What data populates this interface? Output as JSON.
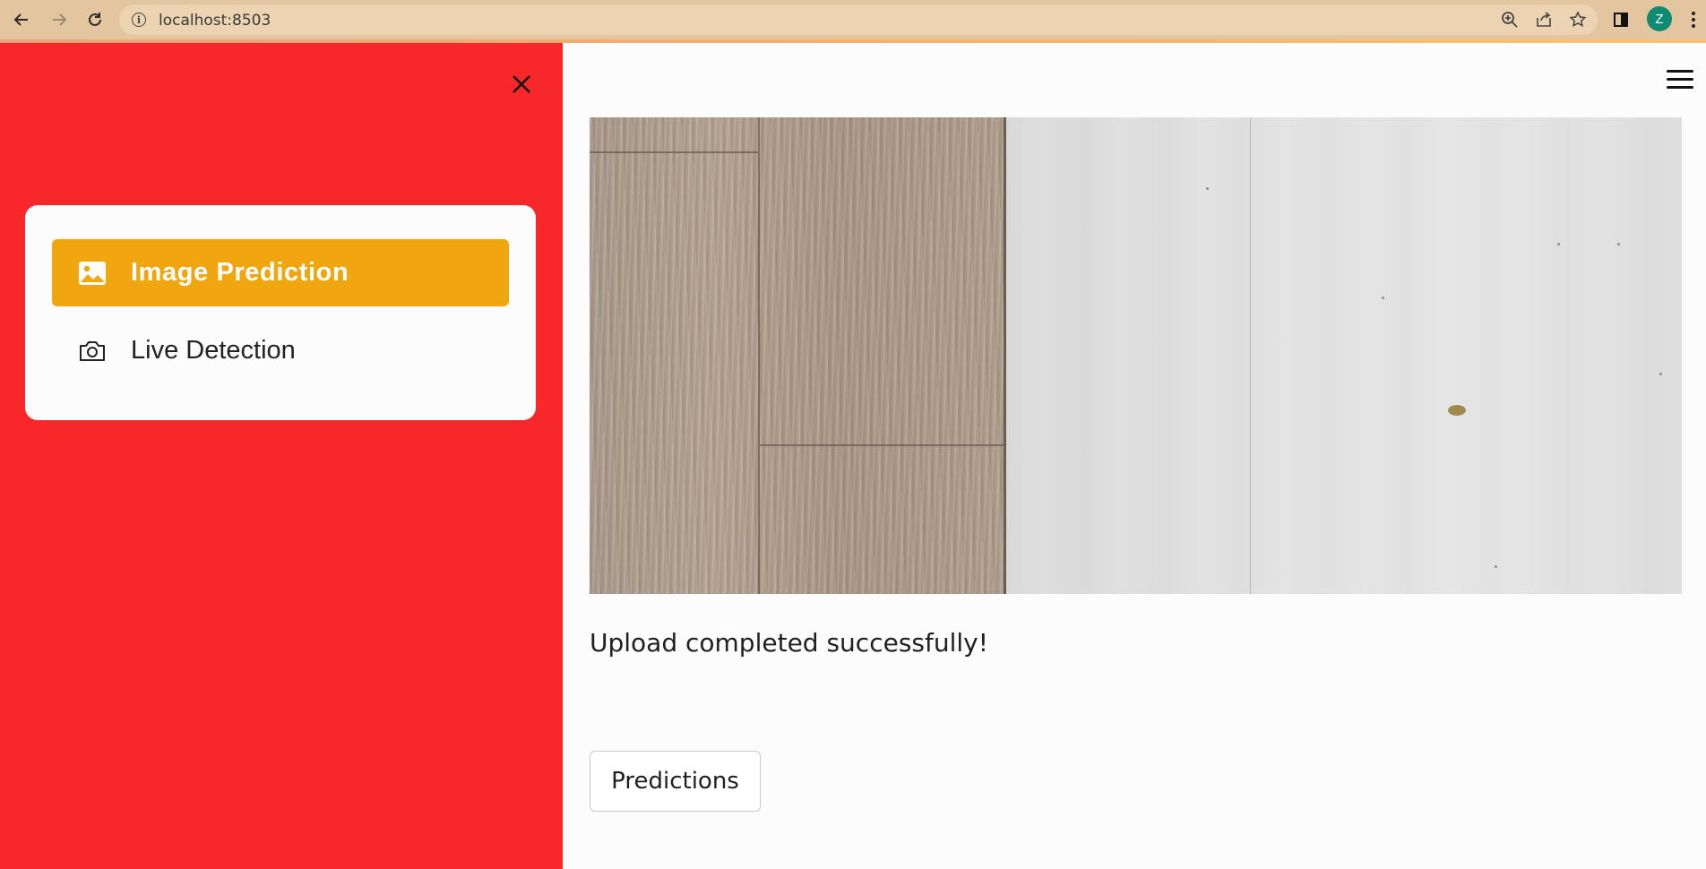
{
  "browser": {
    "url": "localhost:8503",
    "avatar_initial": "Z",
    "icons": [
      "back-arrow-icon",
      "forward-arrow-icon",
      "reload-icon",
      "site-info-icon",
      "zoom-icon",
      "share-icon",
      "bookmark-star-icon",
      "side-panel-icon",
      "more-vert-icon"
    ]
  },
  "sidebar": {
    "background": "#f8272a",
    "items": [
      {
        "label": "Image Prediction",
        "icon": "image-icon",
        "active": true
      },
      {
        "label": "Live Detection",
        "icon": "camera-icon",
        "active": false
      }
    ],
    "accent": "#f0a60f"
  },
  "main": {
    "status_message": "Upload completed successfully!",
    "button_label": "Predictions",
    "image_description": "uploaded floor image"
  }
}
